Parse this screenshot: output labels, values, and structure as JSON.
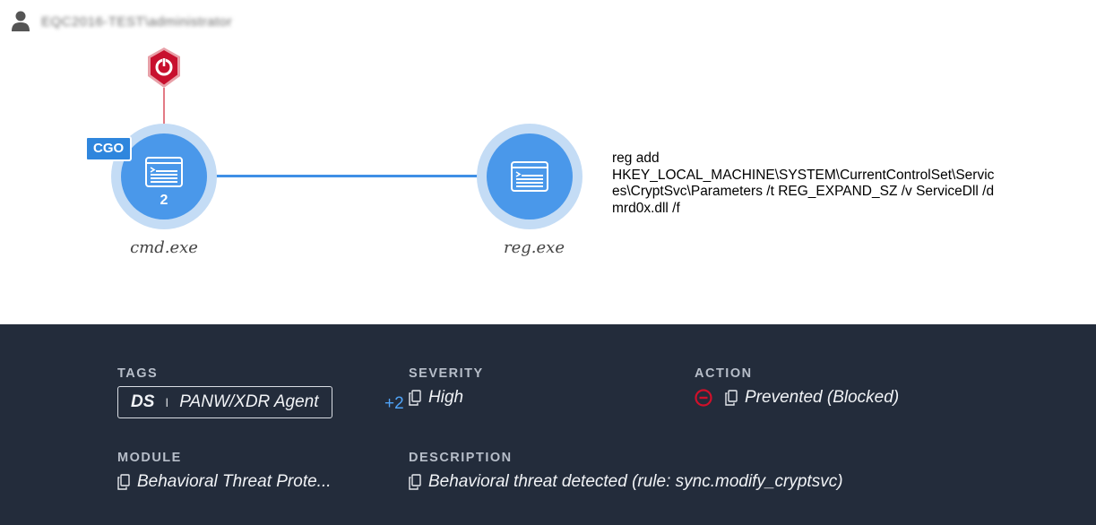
{
  "user": {
    "icon": "user-icon",
    "name": "EQC2016-TEST\\administrator"
  },
  "graph": {
    "alert_icon": "shield-alert-icon",
    "badge": "CGO",
    "nodes": [
      {
        "name": "cmd.exe",
        "count": "2",
        "icon": "process-window-icon"
      },
      {
        "name": "reg.exe",
        "count": "",
        "icon": "process-window-icon"
      }
    ],
    "command_line_lines": [
      "reg add",
      "HKEY_LOCAL_MACHINE\\SYSTEM\\CurrentControlSet\\Servic",
      "es\\CryptSvc\\Parameters /t REG_EXPAND_SZ /v ServiceDll /d",
      "mrd0x.dll /f"
    ]
  },
  "details": {
    "tags": {
      "label": "TAGS",
      "primary": "DS",
      "separator": "I",
      "secondary": "PANW/XDR Agent",
      "more": "+2"
    },
    "severity": {
      "label": "SEVERITY",
      "value": "High"
    },
    "action": {
      "label": "ACTION",
      "value": "Prevented (Blocked)",
      "icon": "blocked-icon"
    },
    "module": {
      "label": "MODULE",
      "value": "Behavioral Threat Prote..."
    },
    "description": {
      "label": "DESCRIPTION",
      "value": "Behavioral threat detected (rule: sync.modify_cryptsvc)"
    }
  },
  "colors": {
    "panel_bg": "#232c3b",
    "node_blue": "#4a98ea",
    "edge_blue": "#3f8fe6",
    "alert_red": "#c8102e",
    "tag_more_blue": "#4fa3f7"
  }
}
